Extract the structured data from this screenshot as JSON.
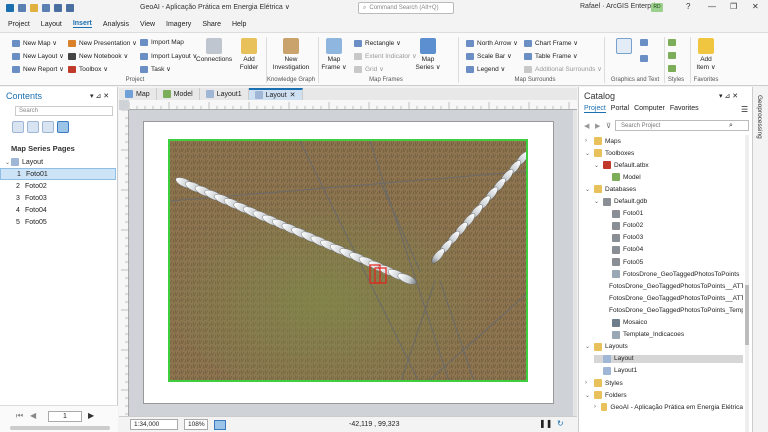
{
  "window": {
    "title": "GeoAI - Aplicação Prática em Energia Elétrica ∨",
    "command_search_placeholder": "Command Search (Alt+Q)",
    "user": "Rafael · ArcGIS Enterprise",
    "user_badge": "RD",
    "controls": [
      "?",
      "—",
      "❐",
      "✕"
    ]
  },
  "menu_tabs": [
    "Project",
    "Layout",
    "Insert",
    "Analysis",
    "View",
    "Imagery",
    "Share",
    "Help"
  ],
  "active_tab": "Insert",
  "ribbon": {
    "project": {
      "new_map": "New Map ∨",
      "new_presentation": "New Presentation ∨",
      "import_map": "Import Map",
      "new_layout": "New Layout ∨",
      "new_notebook": "New Notebook ∨",
      "import_layout": "Import Layout ∨",
      "new_report": "New Report ∨",
      "toolbox": "Toolbox ∨",
      "task": "Task ∨",
      "connections": "Connections",
      "add_folder": "Add Folder",
      "group": "Project"
    },
    "knowledge_graph": {
      "new_investigation": "New Investigation",
      "group": "Knowledge Graph"
    },
    "map_frames": {
      "map_frame": "Map Frame ∨",
      "rectangle": "Rectangle ∨",
      "extent_indicator": "Extent Indicator ∨",
      "grid": "Grid ∨",
      "map_series": "Map Series ∨",
      "group": "Map Frames"
    },
    "map_surrounds": {
      "north_arrow": "North Arrow ∨",
      "scale_bar": "Scale Bar ∨",
      "legend": "Legend ∨",
      "chart_frame": "Chart Frame ∨",
      "table_frame": "Table Frame ∨",
      "additional_surrounds": "Additional Surrounds ∨",
      "group": "Map Surrounds"
    },
    "graphics_text": {
      "group": "Graphics and Text"
    },
    "styles": {
      "group": "Styles"
    },
    "favorites": {
      "add_item": "Add Item ∨",
      "group": "Favorites"
    }
  },
  "contents": {
    "title": "Contents",
    "search_placeholder": "Search",
    "section": "Map Series Pages",
    "layout_label": "Layout",
    "pages": [
      {
        "num": "1",
        "name": "Foto01"
      },
      {
        "num": "2",
        "name": "Foto02"
      },
      {
        "num": "3",
        "name": "Foto03"
      },
      {
        "num": "4",
        "name": "Foto04"
      },
      {
        "num": "5",
        "name": "Foto05"
      }
    ],
    "selected_page": "1",
    "page_input": "1"
  },
  "doc_tabs": [
    {
      "label": "Map",
      "active": false
    },
    {
      "label": "Model",
      "active": false
    },
    {
      "label": "Layout1",
      "active": false
    },
    {
      "label": "Layout",
      "active": true
    }
  ],
  "status": {
    "scale": "1:34,000",
    "zoom": "108%",
    "coords": "-42,119 , 99,323"
  },
  "catalog": {
    "title": "Catalog",
    "tabs": [
      "Project",
      "Portal",
      "Computer",
      "Favorites"
    ],
    "search_placeholder": "Search Project",
    "tree": [
      {
        "label": "Maps",
        "indent": 0,
        "tri": "›",
        "icon": "folder"
      },
      {
        "label": "Toolboxes",
        "indent": 0,
        "tri": "⌄",
        "icon": "folder"
      },
      {
        "label": "Default.atbx",
        "indent": 1,
        "tri": "⌄",
        "icon": "toolbox"
      },
      {
        "label": "Model",
        "indent": 2,
        "tri": "",
        "icon": "model"
      },
      {
        "label": "Databases",
        "indent": 0,
        "tri": "⌄",
        "icon": "folder"
      },
      {
        "label": "Default.gdb",
        "indent": 1,
        "tri": "⌄",
        "icon": "gdb"
      },
      {
        "label": "Foto01",
        "indent": 2,
        "tri": "",
        "icon": "raster"
      },
      {
        "label": "Foto02",
        "indent": 2,
        "tri": "",
        "icon": "raster"
      },
      {
        "label": "Foto03",
        "indent": 2,
        "tri": "",
        "icon": "raster"
      },
      {
        "label": "Foto04",
        "indent": 2,
        "tri": "",
        "icon": "raster"
      },
      {
        "label": "Foto05",
        "indent": 2,
        "tri": "",
        "icon": "raster"
      },
      {
        "label": "FotosDrone_GeoTaggedPhotosToPoints",
        "indent": 2,
        "tri": "",
        "icon": "points"
      },
      {
        "label": "FotosDrone_GeoTaggedPhotosToPoints__ATTA",
        "indent": 2,
        "tri": "",
        "icon": "table"
      },
      {
        "label": "FotosDrone_GeoTaggedPhotosToPoints__ATTA",
        "indent": 2,
        "tri": "",
        "icon": "table"
      },
      {
        "label": "FotosDrone_GeoTaggedPhotosToPoints_Temp",
        "indent": 2,
        "tri": "",
        "icon": "points"
      },
      {
        "label": "Mosaico",
        "indent": 2,
        "tri": "",
        "icon": "mosaic"
      },
      {
        "label": "Template_Indicacoes",
        "indent": 2,
        "tri": "",
        "icon": "points"
      },
      {
        "label": "Layouts",
        "indent": 0,
        "tri": "⌄",
        "icon": "folder"
      },
      {
        "label": "Layout",
        "indent": 1,
        "tri": "",
        "icon": "layout",
        "selected": true
      },
      {
        "label": "Layout1",
        "indent": 1,
        "tri": "",
        "icon": "layout"
      },
      {
        "label": "Styles",
        "indent": 0,
        "tri": "›",
        "icon": "folder"
      },
      {
        "label": "Folders",
        "indent": 0,
        "tri": "⌄",
        "icon": "folder"
      },
      {
        "label": "GeoAI - Aplicação Prática em Energia Elétrica",
        "indent": 1,
        "tri": "›",
        "icon": "folder"
      }
    ]
  },
  "geoprocessing_label": "Geoprocessing",
  "colors": {
    "accent": "#1a6fb0",
    "selection": "#3ecf3e",
    "detection_box": "#e3241b"
  }
}
